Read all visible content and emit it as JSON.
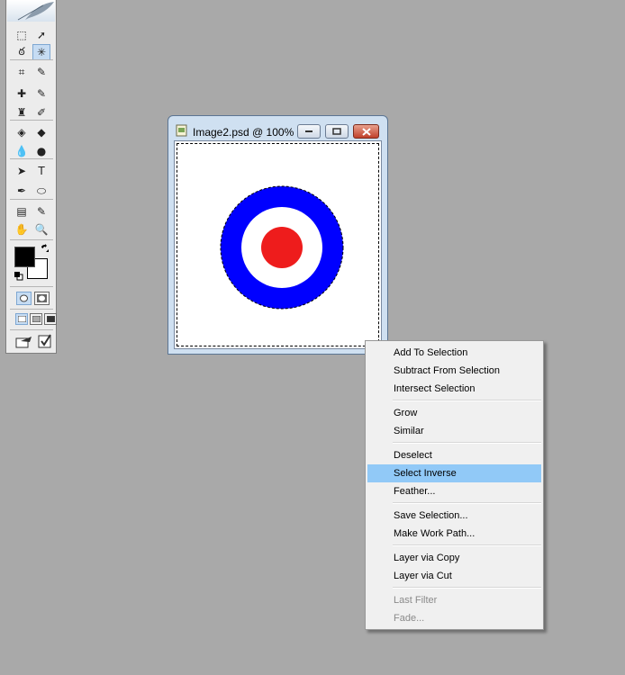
{
  "toolbox": {
    "tools": [
      {
        "name": "rectangular-marquee-icon",
        "glyph": "⬚"
      },
      {
        "name": "move-icon",
        "glyph": "➚"
      },
      {
        "name": "lasso-icon",
        "glyph": "ఠ"
      },
      {
        "name": "magic-wand-icon",
        "glyph": "✳"
      },
      {
        "name": "crop-icon",
        "glyph": "⌗"
      },
      {
        "name": "slice-icon",
        "glyph": "✎"
      },
      {
        "name": "healing-brush-icon",
        "glyph": "✚"
      },
      {
        "name": "brush-icon",
        "glyph": "✎"
      },
      {
        "name": "clone-stamp-icon",
        "glyph": "♜"
      },
      {
        "name": "history-brush-icon",
        "glyph": "✐"
      },
      {
        "name": "eraser-icon",
        "glyph": "◈"
      },
      {
        "name": "paint-bucket-icon",
        "glyph": "◆"
      },
      {
        "name": "blur-icon",
        "glyph": "💧"
      },
      {
        "name": "dodge-icon",
        "glyph": "●"
      },
      {
        "name": "path-selection-icon",
        "glyph": "➤"
      },
      {
        "name": "type-icon",
        "glyph": "T"
      },
      {
        "name": "pen-icon",
        "glyph": "✒"
      },
      {
        "name": "ellipse-shape-icon",
        "glyph": "⬭"
      },
      {
        "name": "notes-icon",
        "glyph": "▤"
      },
      {
        "name": "eyedropper-icon",
        "glyph": "✎"
      },
      {
        "name": "hand-icon",
        "glyph": "✋"
      },
      {
        "name": "zoom-icon",
        "glyph": "🔍"
      }
    ],
    "active_tool": "magic-wand-icon"
  },
  "document": {
    "title": "Image2.psd @ 100% (...",
    "target_colors": {
      "outer": "#0000ff",
      "middle": "#ffffff",
      "inner": "#ee1c1c"
    }
  },
  "context_menu": {
    "groups": [
      [
        "Add To Selection",
        "Subtract From Selection",
        "Intersect Selection"
      ],
      [
        "Grow",
        "Similar"
      ],
      [
        "Deselect",
        "Select Inverse",
        "Feather..."
      ],
      [
        "Save Selection...",
        "Make Work Path..."
      ],
      [
        "Layer via Copy",
        "Layer via Cut"
      ],
      [
        "Last Filter",
        "Fade..."
      ]
    ],
    "highlighted": "Select Inverse",
    "disabled": [
      "Last Filter",
      "Fade..."
    ],
    "highlight_color": "#91c9f7"
  }
}
